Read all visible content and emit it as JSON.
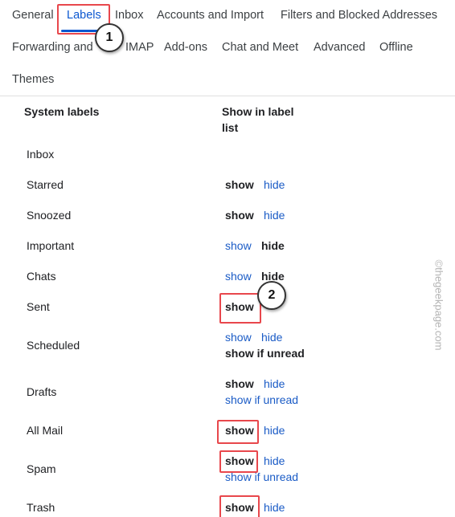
{
  "tabs": {
    "general": "General",
    "labels": "Labels",
    "inbox": "Inbox",
    "accounts": "Accounts and Import",
    "filters": "Filters and Blocked Addresses",
    "forwarding_start": "Forwarding and",
    "forwarding_end": "IMAP",
    "addons": "Add-ons",
    "chat": "Chat and Meet",
    "advanced": "Advanced",
    "offline": "Offline",
    "themes": "Themes"
  },
  "headers": {
    "system_labels": "System labels",
    "show_in_list_line1": "Show in label",
    "show_in_list_line2": "list"
  },
  "labels": [
    {
      "name": "Inbox"
    },
    {
      "name": "Starred",
      "options": [
        "show",
        "hide"
      ],
      "selected": "show"
    },
    {
      "name": "Snoozed",
      "options": [
        "show",
        "hide"
      ],
      "selected": "show"
    },
    {
      "name": "Important",
      "options": [
        "show",
        "hide"
      ],
      "selected": "hide"
    },
    {
      "name": "Chats",
      "options": [
        "show",
        "hide"
      ],
      "selected": "hide"
    },
    {
      "name": "Sent",
      "options": [
        "show"
      ],
      "selected": "show"
    },
    {
      "name": "Scheduled",
      "options": [
        "show",
        "hide",
        "show if unread"
      ],
      "selected": "show if unread"
    },
    {
      "name": "Drafts",
      "options": [
        "show",
        "hide",
        "show if unread"
      ],
      "selected": "show"
    },
    {
      "name": "All Mail",
      "options": [
        "show",
        "hide"
      ],
      "selected": "show"
    },
    {
      "name": "Spam",
      "options": [
        "show",
        "hide",
        "show if unread"
      ],
      "selected": "show"
    },
    {
      "name": "Trash",
      "options": [
        "show",
        "hide"
      ],
      "selected": "show"
    }
  ],
  "annotations": {
    "step1": "1",
    "step2": "2"
  },
  "watermark": "©thegeekpage.com",
  "colors": {
    "accent": "#0b57d0",
    "link": "#1a5bc6",
    "highlight": "#e8474c"
  }
}
